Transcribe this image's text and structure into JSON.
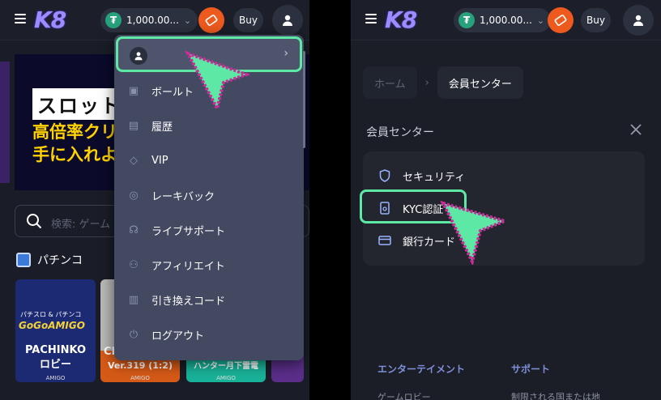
{
  "header": {
    "logo": "K8",
    "balance": "1,000.00...",
    "currency_icon": "tether-icon",
    "buy_label": "Buy"
  },
  "left": {
    "banner": {
      "line1": "スロット",
      "line2": "高倍率クリ",
      "line3": "手に入れよ"
    },
    "search_placeholder": "検索: ゲーム",
    "section_title": "パチンコ",
    "cards": [
      {
        "title": "PACHINKO",
        "subtitle": "ロビー",
        "logo": "GoGoAMIGO",
        "badge": "パチスロ & パチンコ",
        "brand": "AMIGO",
        "bg": "#1c2a73"
      },
      {
        "title": "CI",
        "subtitle": "Ver.319 (1:2)",
        "brand": "AMIGO",
        "bg": "#d65a17"
      },
      {
        "title": "",
        "subtitle": "ハンター月下雷電",
        "brand": "AMIGO",
        "bg": "#19b39a"
      }
    ]
  },
  "dropdown": {
    "items": [
      {
        "label": "ボールト",
        "icon": "vault-icon"
      },
      {
        "label": "履歴",
        "icon": "history-icon"
      },
      {
        "label": "VIP",
        "icon": "diamond-icon"
      },
      {
        "label": "レーキバック",
        "icon": "rakeback-icon"
      },
      {
        "label": "ライブサポート",
        "icon": "headset-icon"
      },
      {
        "label": "アフィリエイト",
        "icon": "users-icon"
      },
      {
        "label": "引き換えコード",
        "icon": "barcode-icon"
      },
      {
        "label": "ログアウト",
        "icon": "logout-icon"
      }
    ]
  },
  "right": {
    "breadcrumb": {
      "home": "ホーム",
      "current": "会員センター"
    },
    "panel_title": "会員センター",
    "items": [
      {
        "label": "セキュリティ",
        "icon": "shield-icon"
      },
      {
        "label": "KYC認証",
        "icon": "document-icon"
      },
      {
        "label": "銀行カード",
        "icon": "card-icon"
      }
    ],
    "footer": {
      "col1": "エンターテイメント",
      "col2": "サポート",
      "col1_item": "ゲームロビー",
      "col2_item": "制限される国または地"
    }
  },
  "colors": {
    "accent": "#5ee8a5",
    "deposit": "#ee5a1e",
    "bg": "#1a1d27",
    "dropdown": "#434960",
    "cursor": "#cc2b9a"
  }
}
